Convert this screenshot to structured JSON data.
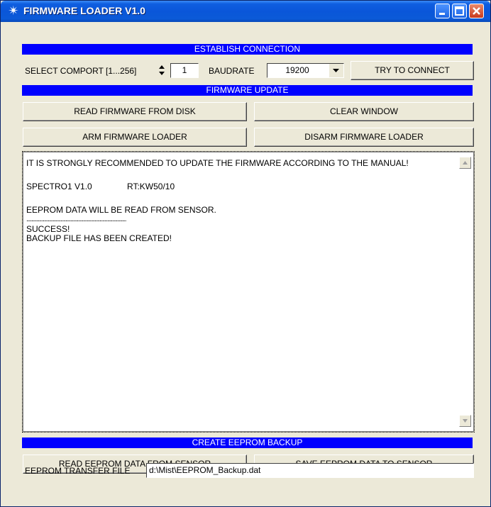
{
  "window": {
    "title": "FIRMWARE LOADER V1.0",
    "icon": "star-icon"
  },
  "connection": {
    "banner": "ESTABLISH CONNECTION",
    "comport_label": "SELECT COMPORT [1...256]",
    "comport_value": "1",
    "baudrate_label": "BAUDRATE",
    "baudrate_value": "19200",
    "connect_button": "TRY TO CONNECT"
  },
  "firmware": {
    "banner": "FIRMWARE UPDATE",
    "read_disk_button": "READ FIRMWARE FROM DISK",
    "clear_button": "CLEAR WINDOW",
    "arm_button": "ARM FIRMWARE LOADER",
    "disarm_button": "DISARM FIRMWARE LOADER"
  },
  "log": {
    "lines": [
      "IT IS STRONGLY RECOMMENDED TO UPDATE THE FIRMWARE ACCORDING TO THE MANUAL!",
      "SPECTRO1 V1.0",
      "RT:KW50/10",
      "EEPROM DATA WILL BE READ FROM SENSOR.",
      "...............................................................................",
      "SUCCESS!",
      "BACKUP FILE HAS BEEN CREATED!"
    ]
  },
  "backup": {
    "banner": "CREATE EEPROM BACKUP",
    "read_button": "READ EEPROM DATA FROM SENSOR",
    "save_button": "SAVE EEPROM DATA TO SENSOR",
    "file_label": "EEPROM TRANSFER FILE",
    "file_value": "d:\\Mist\\EEPROM_Backup.dat"
  },
  "colors": {
    "banner": "#0000ff",
    "titlebar": "#0a56d9",
    "face": "#ece9d8"
  }
}
